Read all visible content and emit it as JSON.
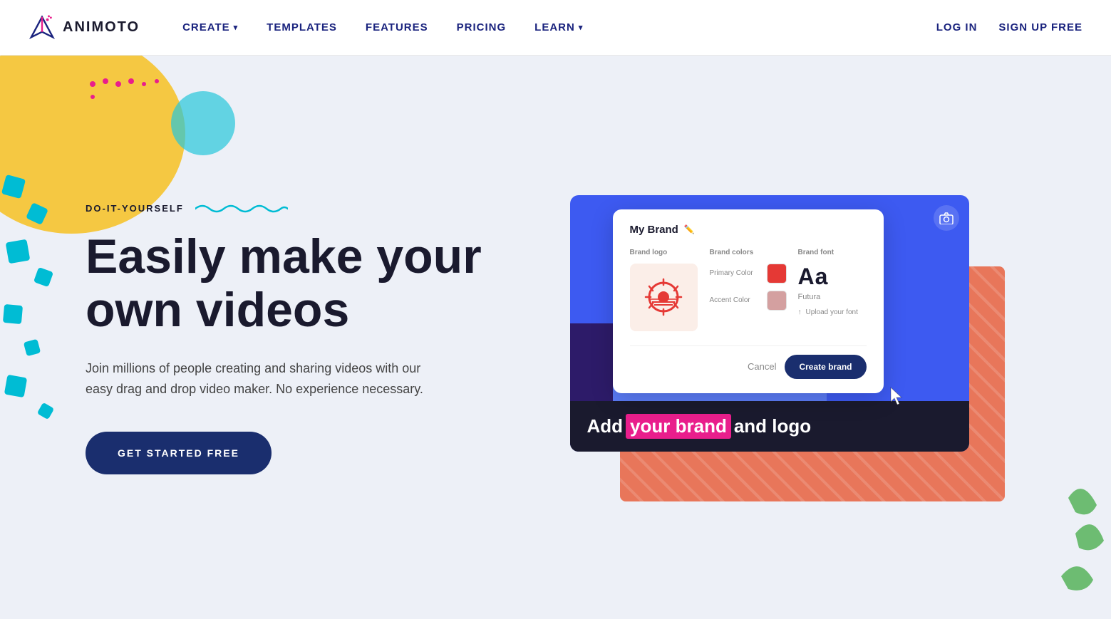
{
  "brand": {
    "logo_text": "ANIMOTO"
  },
  "nav": {
    "create_label": "CREATE",
    "templates_label": "TEMPLATES",
    "features_label": "FEATURES",
    "pricing_label": "PRICING",
    "learn_label": "LEARN",
    "login_label": "LOG IN",
    "signup_label": "SIGN UP FREE"
  },
  "hero": {
    "diy_label": "DO-IT-YOURSELF",
    "title_line1": "Easily make your",
    "title_line2": "own videos",
    "subtitle": "Join millions of people creating and sharing videos with our easy drag and drop video maker. No experience necessary.",
    "cta_label": "GET STARTED FREE"
  },
  "mockup": {
    "modal_title": "My Brand",
    "brand_logo_col": "Brand logo",
    "brand_colors_col": "Brand colors",
    "brand_font_col": "Brand font",
    "primary_color_label": "Primary Color",
    "primary_color_value": "#e53935",
    "accent_color_label": "Accent Color",
    "accent_color_value": "#d4a0a0",
    "font_preview": "Aa",
    "font_name": "Futura",
    "upload_font_label": "Upload your font",
    "cancel_label": "Cancel",
    "create_brand_label": "Create brand",
    "bottom_text_before": "Add ",
    "bottom_text_highlight": "your brand",
    "bottom_text_after": " and logo"
  },
  "colors": {
    "nav_text": "#1a237e",
    "hero_bg": "#edf0f7",
    "cta_bg": "#1a2e6e",
    "yellow_deco": "#f5c842",
    "teal_deco": "#26c6da",
    "modal_create_btn": "#1a2e6e",
    "highlight_pink": "#e91e8c",
    "coral": "#e8765a",
    "blue_panel": "#3d5af1"
  }
}
